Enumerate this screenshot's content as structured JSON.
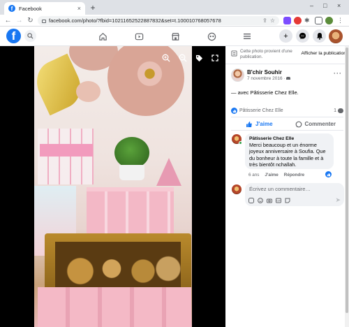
{
  "browser": {
    "tab_title": "Facebook",
    "tab_close": "×",
    "new_tab": "+",
    "url": "facebook.com/photo/?fbid=1021165252288783​2&set=t.100010768057678",
    "window_min": "–",
    "window_max": "□",
    "window_close": "×"
  },
  "fb_nav": {
    "logo": "f",
    "icons": [
      "home-icon",
      "watch-icon",
      "marketplace-icon",
      "groups-icon",
      "menu-icon"
    ]
  },
  "photo_controls": [
    "zoom-in-icon",
    "zoom-out-icon",
    "tag-icon",
    "fullscreen-icon"
  ],
  "sidebar": {
    "notice_text": "Cette photo provient d'une publication.",
    "notice_link": "Afficher la publication",
    "author": "B'chir Souhir",
    "date": "7 novembre 2016 ·",
    "with_text": "— avec Pâtisserie Chez Elle.",
    "reaction_name": "Pâtisserie Chez Elle",
    "comment_count": "1",
    "like_label": "J'aime",
    "comment_label": "Commenter",
    "comment": {
      "name": "Pâtisserie Chez Elle",
      "text": "Merci beaucoup et un énorme joyeux anniversaire à Soufia. Que du bonheur à toute la famille et à très bientôt nchallah.",
      "age": "6 ans",
      "like": "J'aime",
      "reply": "Répondre"
    },
    "composer_placeholder": "Écrivez un commentaire…"
  },
  "colors": {
    "fb_blue": "#1877f2",
    "secondary_text": "#65676b",
    "bubble_bg": "#f0f2f5"
  }
}
